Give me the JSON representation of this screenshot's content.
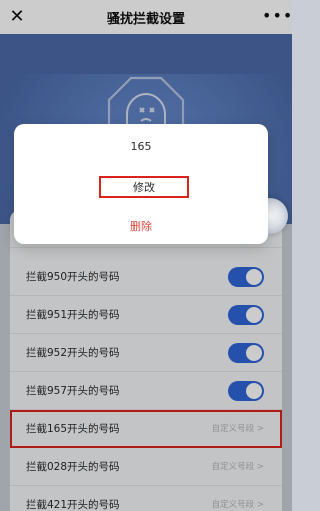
{
  "header": {
    "close_icon": "close-icon",
    "title": "骚扰拦截设置",
    "more_icon": "more-icon"
  },
  "dialog": {
    "number": "165",
    "edit_label": "修改",
    "delete_label": "删除"
  },
  "rows": [
    {
      "label": "拦截950开头的号码",
      "control": "toggle",
      "on": true
    },
    {
      "label": "拦截951开头的号码",
      "control": "toggle",
      "on": true
    },
    {
      "label": "拦截952开头的号码",
      "control": "toggle",
      "on": true
    },
    {
      "label": "拦截957开头的号码",
      "control": "toggle",
      "on": true
    },
    {
      "label": "拦截165开头的号码",
      "control": "hint",
      "hint": "自定义号段 >"
    },
    {
      "label": "拦截028开头的号码",
      "control": "hint",
      "hint": "自定义号段 >"
    },
    {
      "label": "拦截421开头的号码",
      "control": "hint",
      "hint": "自定义号段 >"
    }
  ],
  "colors": {
    "accent": "#2f65d6",
    "highlight": "#d9241c",
    "danger": "#e0443b"
  }
}
